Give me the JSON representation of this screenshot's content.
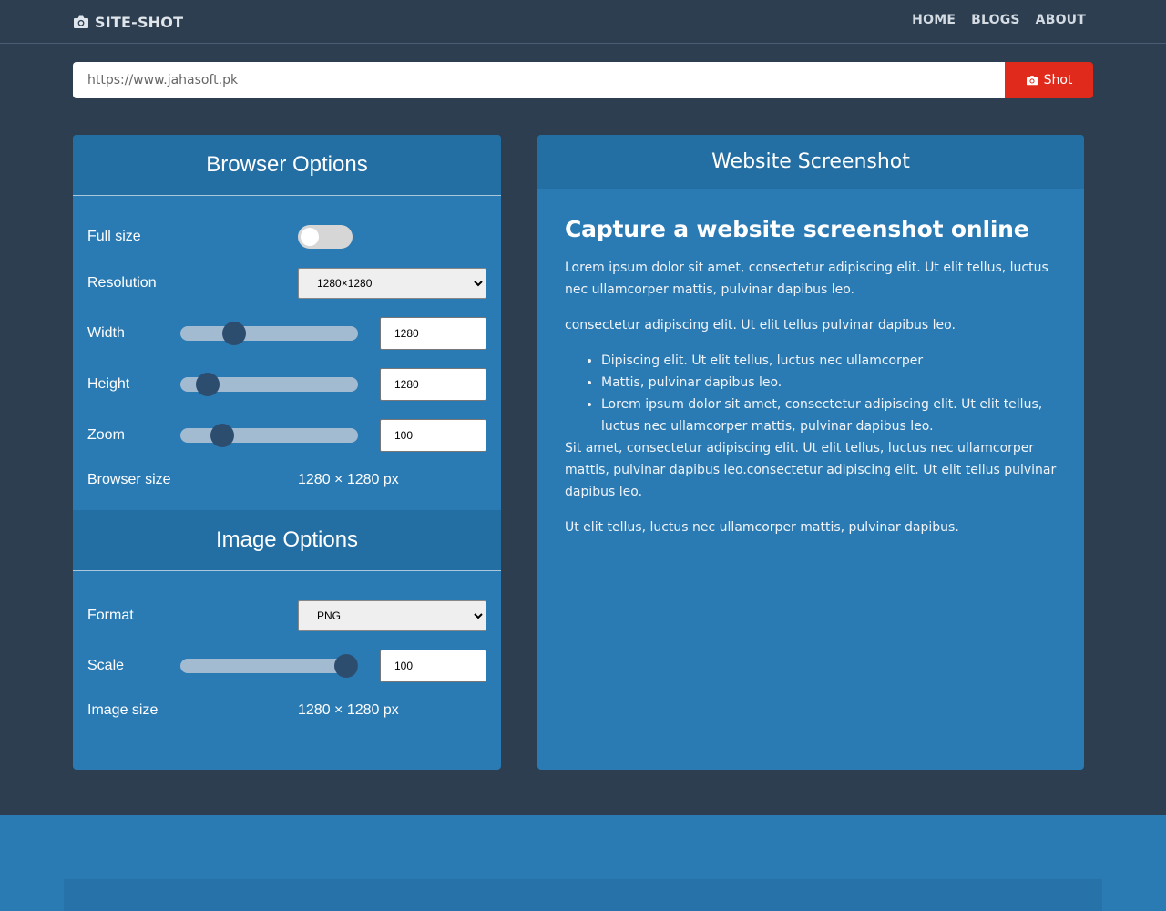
{
  "nav": {
    "brand": "SITE-SHOT",
    "brand_icon": "camera-icon",
    "links": [
      "HOME",
      "BLOGS",
      "ABOUT"
    ]
  },
  "urlbar": {
    "url": "https://www.jahasoft.pk",
    "button_label": "Shot",
    "button_icon": "camera-icon",
    "button_color": "#e02a1b"
  },
  "browser_options": {
    "title": "Browser Options",
    "full_size_label": "Full size",
    "full_size_on": false,
    "resolution_label": "Resolution",
    "resolution_value": "1280×1280",
    "width_label": "Width",
    "width_value": "1280",
    "height_label": "Height",
    "height_value": "1280",
    "zoom_label": "Zoom",
    "zoom_value": "100",
    "browser_size_label": "Browser size",
    "browser_size_value": "1280 × 1280 px"
  },
  "image_options": {
    "title": "Image Options",
    "format_label": "Format",
    "format_value": "PNG",
    "scale_label": "Scale",
    "scale_value": "100",
    "image_size_label": "Image size",
    "image_size_value": "1280 × 1280 px"
  },
  "website": {
    "title": "Website Screenshot",
    "heading": "Capture a website screenshot online",
    "p1": "Lorem ipsum dolor sit amet, consectetur adipiscing elit. Ut elit tellus, luctus nec ullamcorper mattis, pulvinar dapibus leo.",
    "p2": "consectetur adipiscing elit. Ut elit tellus pulvinar dapibus leo.",
    "list": [
      "Dipiscing elit. Ut elit tellus, luctus nec ullamcorper",
      "Mattis, pulvinar dapibus leo.",
      "Lorem ipsum dolor sit amet, consectetur adipiscing elit. Ut elit tellus, luctus nec ullamcorper mattis, pulvinar dapibus leo."
    ],
    "p3": "Sit amet, consectetur adipiscing elit. Ut elit tellus, luctus nec ullamcorper mattis, pulvinar dapibus leo.consectetur adipiscing elit. Ut elit tellus pulvinar dapibus leo.",
    "p4": "Ut elit tellus, luctus nec ullamcorper mattis, pulvinar dapibus."
  },
  "colors": {
    "background": "#2c3e50",
    "panel": "#2a7ab4",
    "panel_header": "#236ea3",
    "accent": "#e02a1b"
  }
}
